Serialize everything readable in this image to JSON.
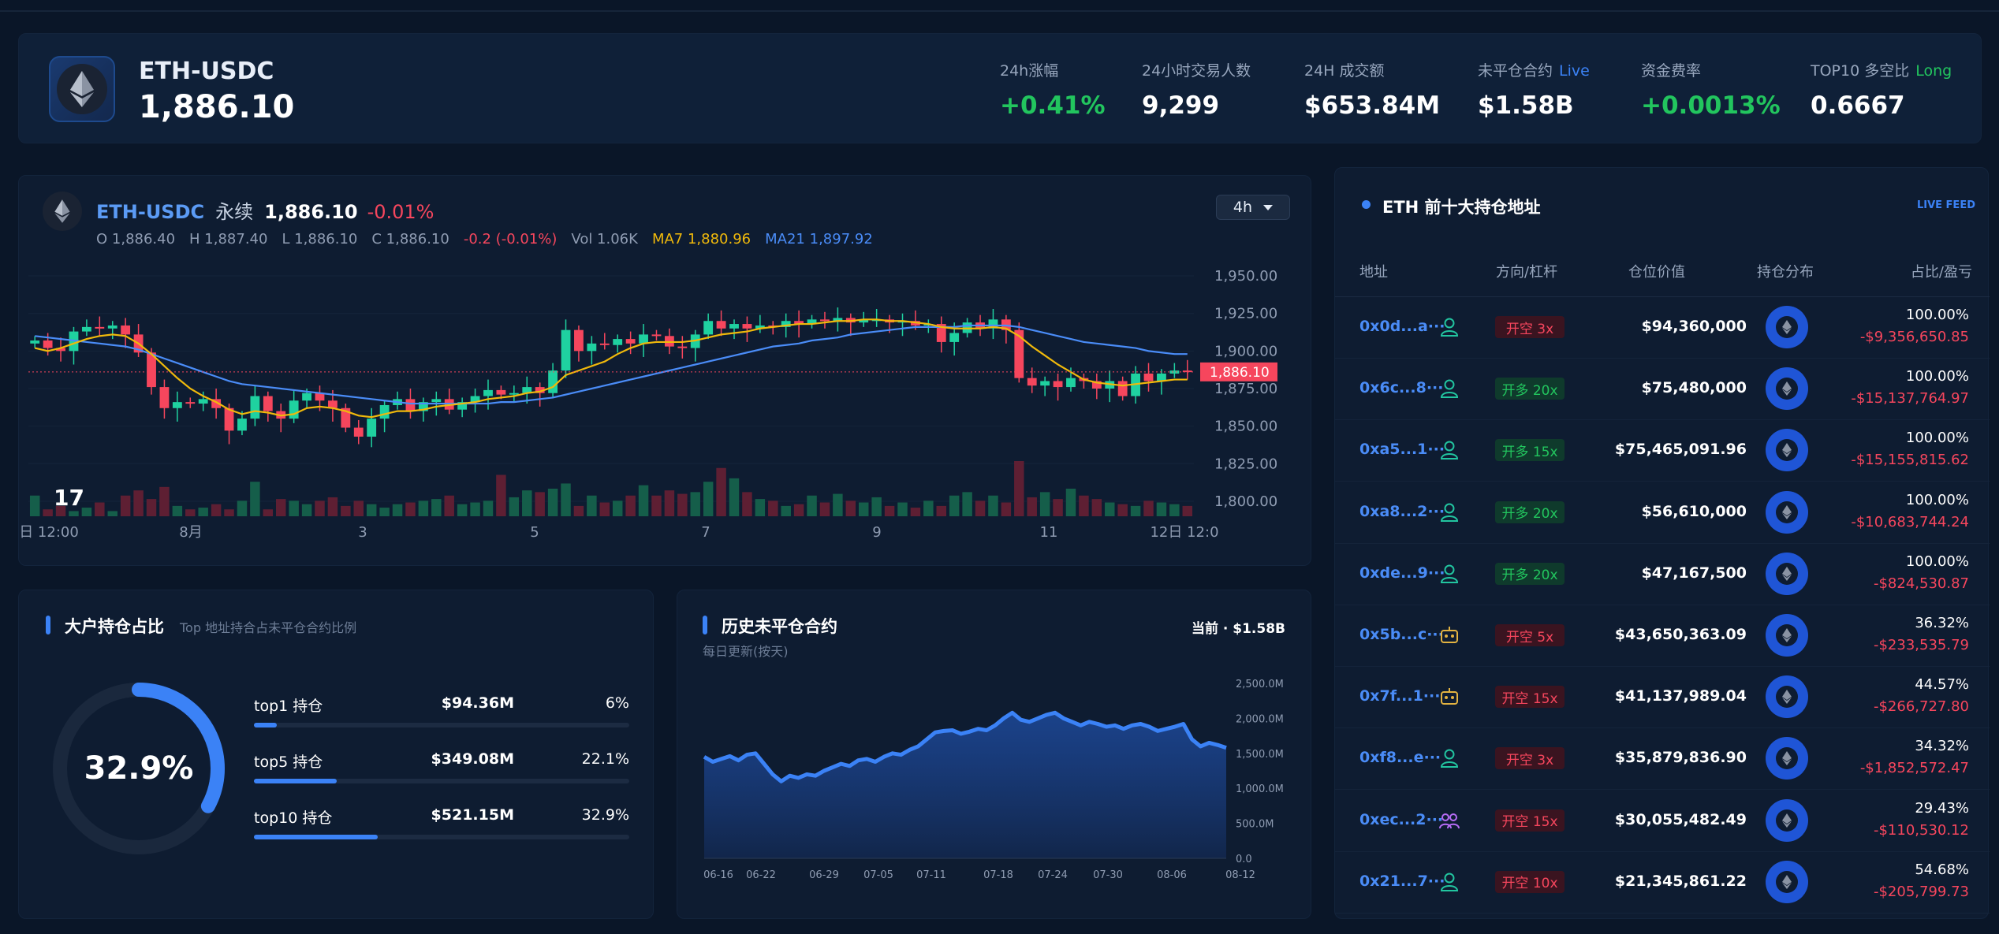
{
  "header": {
    "pair": "ETH-USDC",
    "price": "1,886.10",
    "stats": [
      {
        "label": "24h涨幅",
        "tag": "",
        "value": "+0.41%",
        "positive": true
      },
      {
        "label": "24小时交易人数",
        "tag": "",
        "value": "9,299",
        "positive": false
      },
      {
        "label": "24H 成交额",
        "tag": "",
        "value": "$653.84M",
        "positive": false
      },
      {
        "label": "未平仓合约",
        "tag": "Live",
        "value": "$1.58B",
        "positive": false
      },
      {
        "label": "资金费率",
        "tag": "",
        "value": "+0.0013%",
        "positive": true
      },
      {
        "label": "TOP10 多空比",
        "tag": "Long",
        "value": "0.6667",
        "positive": false
      }
    ]
  },
  "price_chart": {
    "pair": "ETH-USDC",
    "type_label": "永续",
    "price": "1,886.10",
    "change": "-0.01%",
    "ohlc": {
      "o": "O 1,886.40",
      "h": "H 1,887.40",
      "l": "L 1,886.10",
      "c": "C 1,886.10",
      "chg": "-0.2 (-0.01%)",
      "vol": "Vol 1.06K",
      "ma7": "MA7 1,880.96",
      "ma21": "MA21 1,897.92"
    },
    "timeframe": "4h",
    "last_price_tag": "1,886.10",
    "colors": {
      "up": "#1fd1a0",
      "down": "#f6465d",
      "ma7": "#f0b90b",
      "ma21": "#4a8cf7",
      "vol_up": "#155e4a",
      "vol_down": "#5e1f33"
    }
  },
  "holders_share": {
    "title": "大户持仓占比",
    "subtitle": "Top 地址持合占未平仓合约比例",
    "center": "32.9%",
    "rows": [
      {
        "name": "top1 持仓",
        "amount": "$94.36M",
        "pct": "6%",
        "fraction": 0.06
      },
      {
        "name": "top5 持仓",
        "amount": "$349.08M",
        "pct": "22.1%",
        "fraction": 0.221
      },
      {
        "name": "top10 持仓",
        "amount": "$521.15M",
        "pct": "32.9%",
        "fraction": 0.329
      }
    ]
  },
  "oi_history": {
    "title": "历史未平仓合约",
    "subtitle": "每日更新(按天)",
    "current": "当前 · $1.58B"
  },
  "top_holders": {
    "title": "ETH 前十大持仓地址",
    "live": "LIVE FEED",
    "headers": [
      "地址",
      "方向/杠杆",
      "仓位价值",
      "持仓分布",
      "占比/盈亏"
    ],
    "rows": [
      {
        "addr": "0x0d...a···",
        "icon": "user-icon",
        "side": "开空 3x",
        "dir": "short",
        "value": "$94,360,000",
        "pct": "100.00%",
        "pnl": "-$9,356,650.85"
      },
      {
        "addr": "0x6c...8···",
        "icon": "user-icon",
        "side": "开多 20x",
        "dir": "long",
        "value": "$75,480,000",
        "pct": "100.00%",
        "pnl": "-$15,137,764.97"
      },
      {
        "addr": "0xa5...1···",
        "icon": "user-icon",
        "side": "开多 15x",
        "dir": "long",
        "value": "$75,465,091.96",
        "pct": "100.00%",
        "pnl": "-$15,155,815.62"
      },
      {
        "addr": "0xa8...2···",
        "icon": "user-icon",
        "side": "开多 20x",
        "dir": "long",
        "value": "$56,610,000",
        "pct": "100.00%",
        "pnl": "-$10,683,744.24"
      },
      {
        "addr": "0xde...9···",
        "icon": "user-icon",
        "side": "开多 20x",
        "dir": "long",
        "value": "$47,167,500",
        "pct": "100.00%",
        "pnl": "-$824,530.87"
      },
      {
        "addr": "0x5b...c···",
        "icon": "robot-icon",
        "side": "开空 5x",
        "dir": "short",
        "value": "$43,650,363.09",
        "pct": "36.32%",
        "pnl": "-$233,535.79"
      },
      {
        "addr": "0x7f...1···",
        "icon": "robot-icon",
        "side": "开空 15x",
        "dir": "short",
        "value": "$41,137,989.04",
        "pct": "44.57%",
        "pnl": "-$266,727.80"
      },
      {
        "addr": "0xf8...e···",
        "icon": "user-icon",
        "side": "开空 3x",
        "dir": "short",
        "value": "$35,879,836.90",
        "pct": "34.32%",
        "pnl": "-$1,852,572.47"
      },
      {
        "addr": "0xec...2···",
        "icon": "group-icon",
        "side": "开空 15x",
        "dir": "short",
        "value": "$30,055,482.49",
        "pct": "29.43%",
        "pnl": "-$110,530.12"
      },
      {
        "addr": "0x21...7···",
        "icon": "user-icon",
        "side": "开空 10x",
        "dir": "short",
        "value": "$21,345,861.22",
        "pct": "54.68%",
        "pnl": "-$205,799.73"
      }
    ]
  },
  "chart_data": [
    {
      "type": "candlestick",
      "ylim": [
        1790,
        1960
      ],
      "y_ticks": [
        "1,950.00",
        "1,925.00",
        "1,900.00",
        "1,875.00",
        "1,850.00",
        "1,825.00",
        "1,800.00"
      ],
      "x_ticks": [
        "日 12:00",
        "8月",
        "3",
        "5",
        "7",
        "9",
        "11",
        "12日 12:0"
      ],
      "close": [
        1907,
        1902,
        1900,
        1913,
        1916,
        1915,
        1917,
        1911,
        1899,
        1876,
        1862,
        1866,
        1865,
        1868,
        1862,
        1847,
        1855,
        1870,
        1860,
        1855,
        1867,
        1872,
        1867,
        1862,
        1849,
        1843,
        1855,
        1864,
        1868,
        1860,
        1866,
        1868,
        1861,
        1866,
        1870,
        1874,
        1871,
        1872,
        1876,
        1872,
        1887,
        1914,
        1900,
        1905,
        1904,
        1908,
        1905,
        1911,
        1910,
        1903,
        1902,
        1911,
        1920,
        1915,
        1918,
        1915,
        1917,
        1916,
        1920,
        1918,
        1921,
        1920,
        1922,
        1919,
        1921,
        1921,
        1919,
        1920,
        1917,
        1918,
        1906,
        1912,
        1919,
        1915,
        1921,
        1914,
        1882,
        1877,
        1880,
        1876,
        1882,
        1880,
        1875,
        1880,
        1870,
        1885,
        1880,
        1885,
        1887,
        1886
      ],
      "volume": [
        12,
        4,
        6,
        3,
        5,
        8,
        3,
        12,
        15,
        10,
        17,
        6,
        4,
        5,
        7,
        4,
        9,
        20,
        4,
        10,
        9,
        7,
        9,
        11,
        6,
        9,
        7,
        5,
        7,
        8,
        9,
        10,
        12,
        7,
        8,
        9,
        24,
        11,
        15,
        14,
        16,
        19,
        6,
        12,
        8,
        9,
        12,
        18,
        12,
        15,
        13,
        14,
        20,
        28,
        22,
        14,
        10,
        9,
        6,
        7,
        12,
        8,
        13,
        9,
        8,
        11,
        6,
        8,
        5,
        9,
        6,
        12,
        14,
        9,
        12,
        8,
        32,
        11,
        14,
        10,
        16,
        12,
        10,
        8,
        7,
        6,
        9,
        8,
        7,
        6
      ],
      "ma7": [
        1902,
        1900,
        1902,
        1905,
        1908,
        1910,
        1911,
        1910,
        1905,
        1898,
        1890,
        1882,
        1875,
        1870,
        1866,
        1861,
        1858,
        1860,
        1859,
        1857,
        1858,
        1862,
        1863,
        1862,
        1860,
        1857,
        1856,
        1858,
        1860,
        1860,
        1861,
        1863,
        1864,
        1865,
        1866,
        1868,
        1869,
        1870,
        1872,
        1873,
        1876,
        1884,
        1887,
        1890,
        1893,
        1898,
        1902,
        1905,
        1906,
        1906,
        1906,
        1907,
        1909,
        1911,
        1912,
        1913,
        1915,
        1916,
        1917,
        1918,
        1918,
        1919,
        1920,
        1920,
        1921,
        1921,
        1920,
        1920,
        1919,
        1918,
        1916,
        1915,
        1915,
        1915,
        1916,
        1915,
        1910,
        1903,
        1897,
        1891,
        1886,
        1881,
        1879,
        1878,
        1877,
        1878,
        1879,
        1880,
        1881,
        1881
      ],
      "ma21": [
        1910,
        1909,
        1908,
        1907,
        1906,
        1905,
        1904,
        1903,
        1901,
        1898,
        1895,
        1892,
        1889,
        1886,
        1883,
        1880,
        1878,
        1877,
        1876,
        1875,
        1874,
        1873,
        1872,
        1871,
        1870,
        1869,
        1868,
        1867,
        1866,
        1865,
        1865,
        1865,
        1865,
        1865,
        1865,
        1865,
        1866,
        1866,
        1867,
        1868,
        1869,
        1871,
        1873,
        1875,
        1877,
        1879,
        1881,
        1883,
        1885,
        1887,
        1889,
        1891,
        1893,
        1895,
        1897,
        1899,
        1901,
        1903,
        1904,
        1905,
        1907,
        1908,
        1909,
        1911,
        1912,
        1913,
        1914,
        1915,
        1916,
        1916,
        1916,
        1916,
        1917,
        1917,
        1917,
        1917,
        1916,
        1914,
        1912,
        1910,
        1908,
        1906,
        1905,
        1904,
        1903,
        1902,
        1900,
        1899,
        1898,
        1898
      ]
    },
    {
      "type": "area",
      "x_ticks": [
        "06-16",
        "06-22",
        "06-29",
        "07-05",
        "07-11",
        "07-18",
        "07-24",
        "07-30",
        "08-06",
        "08-12"
      ],
      "y_ticks": [
        "2,500.0M",
        "2,000.0M",
        "1,500.0M",
        "1,000.0M",
        "500.0M",
        "0.0"
      ],
      "ylim": [
        0,
        2500
      ],
      "values": [
        1450,
        1380,
        1420,
        1460,
        1400,
        1480,
        1500,
        1350,
        1200,
        1100,
        1180,
        1150,
        1200,
        1180,
        1250,
        1300,
        1350,
        1320,
        1400,
        1420,
        1380,
        1450,
        1500,
        1480,
        1550,
        1600,
        1700,
        1800,
        1820,
        1830,
        1780,
        1810,
        1850,
        1830,
        1900,
        2000,
        2080,
        1980,
        1950,
        2000,
        2050,
        2080,
        2000,
        1950,
        1900,
        1950,
        1920,
        1880,
        1900,
        1850,
        1900,
        1920,
        1880,
        1820,
        1850,
        1880,
        1920,
        1700,
        1600,
        1650,
        1620,
        1580
      ]
    }
  ]
}
